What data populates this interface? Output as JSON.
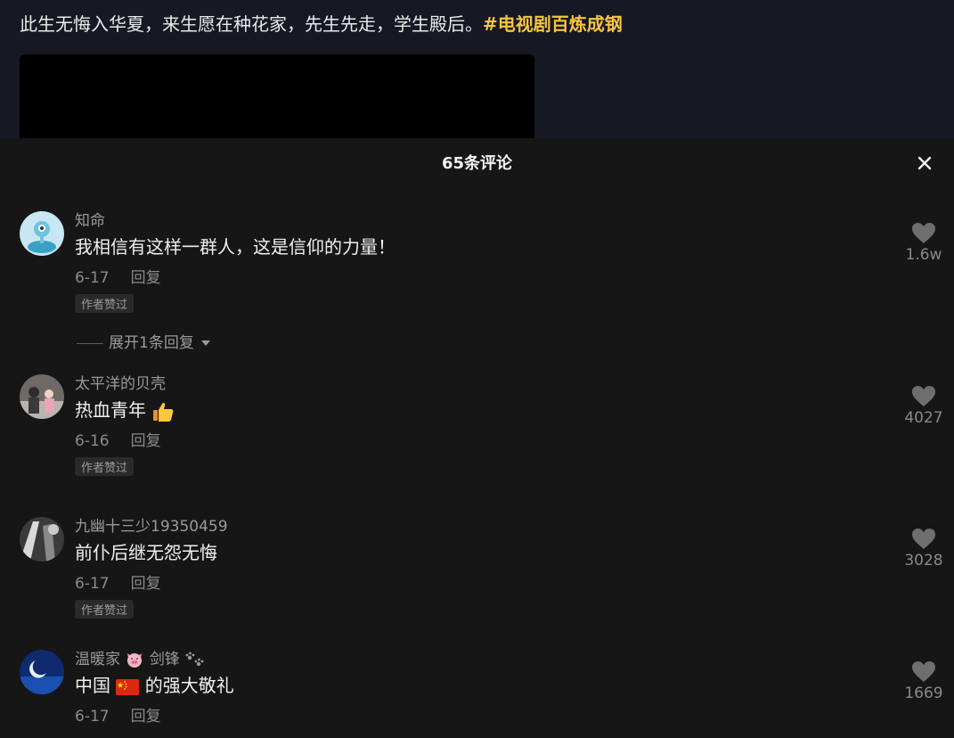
{
  "post": {
    "caption": "此生无悔入华夏，来生愿在种花家，先生先走，学生殿后。",
    "hashtag": "#电视剧百炼成钢"
  },
  "comments_panel": {
    "title": "65条评论",
    "close_icon": "close-icon"
  },
  "comments": [
    {
      "username": "知命",
      "text": "我相信有这样一群人，这是信仰的力量！",
      "date": "6-17",
      "reply_label": "回复",
      "badge": "作者赞过",
      "likes": "1.6w",
      "expand_label": "展开1条回复"
    },
    {
      "username": "太平洋的贝壳",
      "text": "热血青年",
      "emoji": "thumbs-up-emoji",
      "date": "6-16",
      "reply_label": "回复",
      "badge": "作者赞过",
      "likes": "4027"
    },
    {
      "username": "九幽十三少19350459",
      "text": "前仆后继无怨无悔",
      "date": "6-17",
      "reply_label": "回复",
      "badge": "作者赞过",
      "likes": "3028"
    },
    {
      "username_prefix": "温暖家",
      "username_suffix": "剑锋",
      "text_prefix": "中国",
      "text_suffix": "的强大敬礼",
      "date": "6-17",
      "reply_label": "回复",
      "likes": "1669"
    }
  ],
  "colors": {
    "hashtag": "#f4c542",
    "background": "#161616",
    "header_bg": "#161823"
  }
}
